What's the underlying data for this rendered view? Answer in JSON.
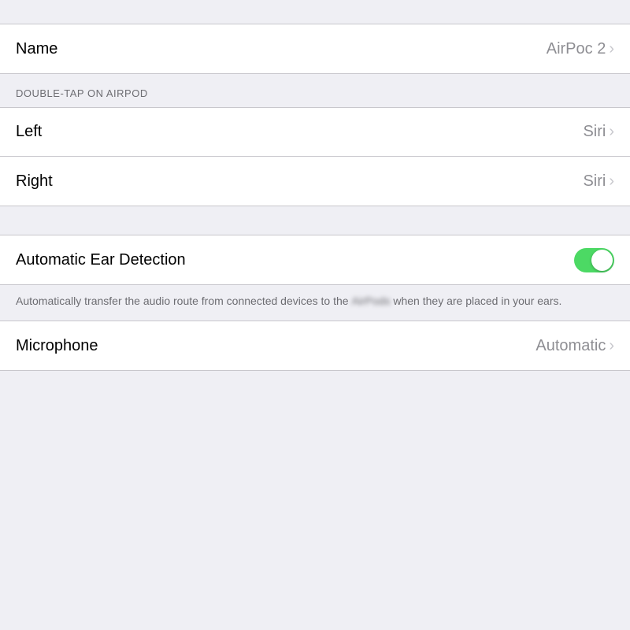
{
  "settings": {
    "top_spacer_height": 30,
    "name_row": {
      "label": "Name",
      "value": "AirPoc 2",
      "show_chevron": true
    },
    "double_tap_section": {
      "header": "DOUBLE-TAP ON AIRPOD",
      "left_row": {
        "label": "Left",
        "value": "Siri",
        "show_chevron": true
      },
      "right_row": {
        "label": "Right",
        "value": "Siri",
        "show_chevron": true
      }
    },
    "ear_detection_row": {
      "label": "Automatic Ear Detection",
      "toggle_enabled": true
    },
    "description": {
      "text_before_blur": "Automatically transfer the audio route from connected devices to the ",
      "blurred_word": "AirPods",
      "text_after_blur": " when they are placed in your ears."
    },
    "microphone_row": {
      "label": "Microphone",
      "value": "Automatic",
      "show_chevron": true
    }
  },
  "colors": {
    "background": "#efeff4",
    "card_bg": "#ffffff",
    "border": "#c8c7cc",
    "label_primary": "#000000",
    "label_secondary": "#8e8e93",
    "section_header": "#6d6d72",
    "toggle_on": "#4cd964",
    "chevron": "#c7c7cc"
  }
}
